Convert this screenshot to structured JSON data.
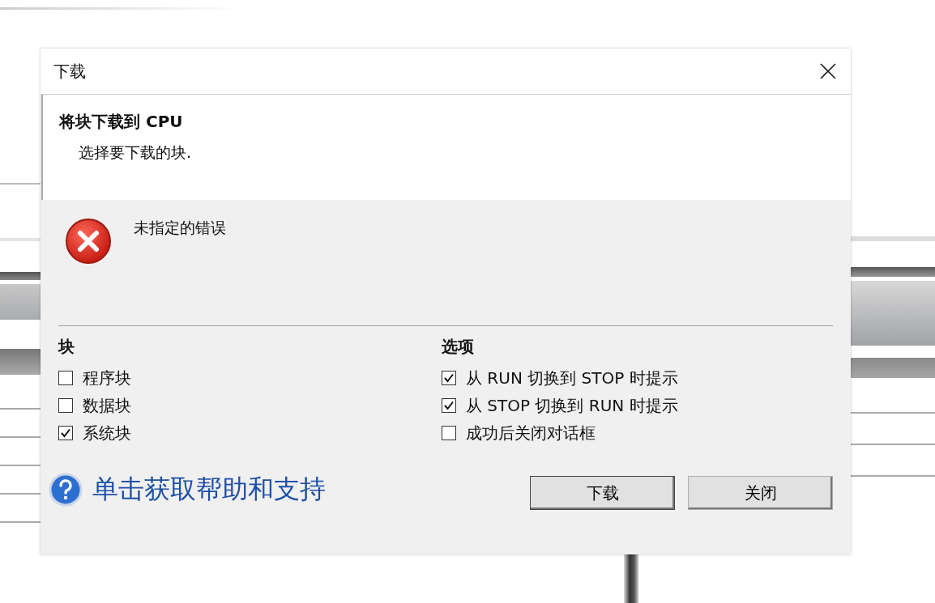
{
  "window": {
    "title": "下载"
  },
  "header": {
    "title": "将块下载到 CPU",
    "subtitle": "选择要下载的块."
  },
  "error": {
    "message": "未指定的错误"
  },
  "blocks": {
    "title": "块",
    "items": [
      {
        "label": "程序块",
        "checked": false
      },
      {
        "label": "数据块",
        "checked": false
      },
      {
        "label": "系统块",
        "checked": true
      }
    ]
  },
  "options": {
    "title": "选项",
    "items": [
      {
        "label": "从 RUN 切换到 STOP 时提示",
        "checked": true
      },
      {
        "label": "从 STOP 切换到 RUN 时提示",
        "checked": true
      },
      {
        "label": "成功后关闭对话框",
        "checked": false
      }
    ]
  },
  "help_link": "单击获取帮助和支持",
  "buttons": [
    "下载",
    "关闭"
  ]
}
